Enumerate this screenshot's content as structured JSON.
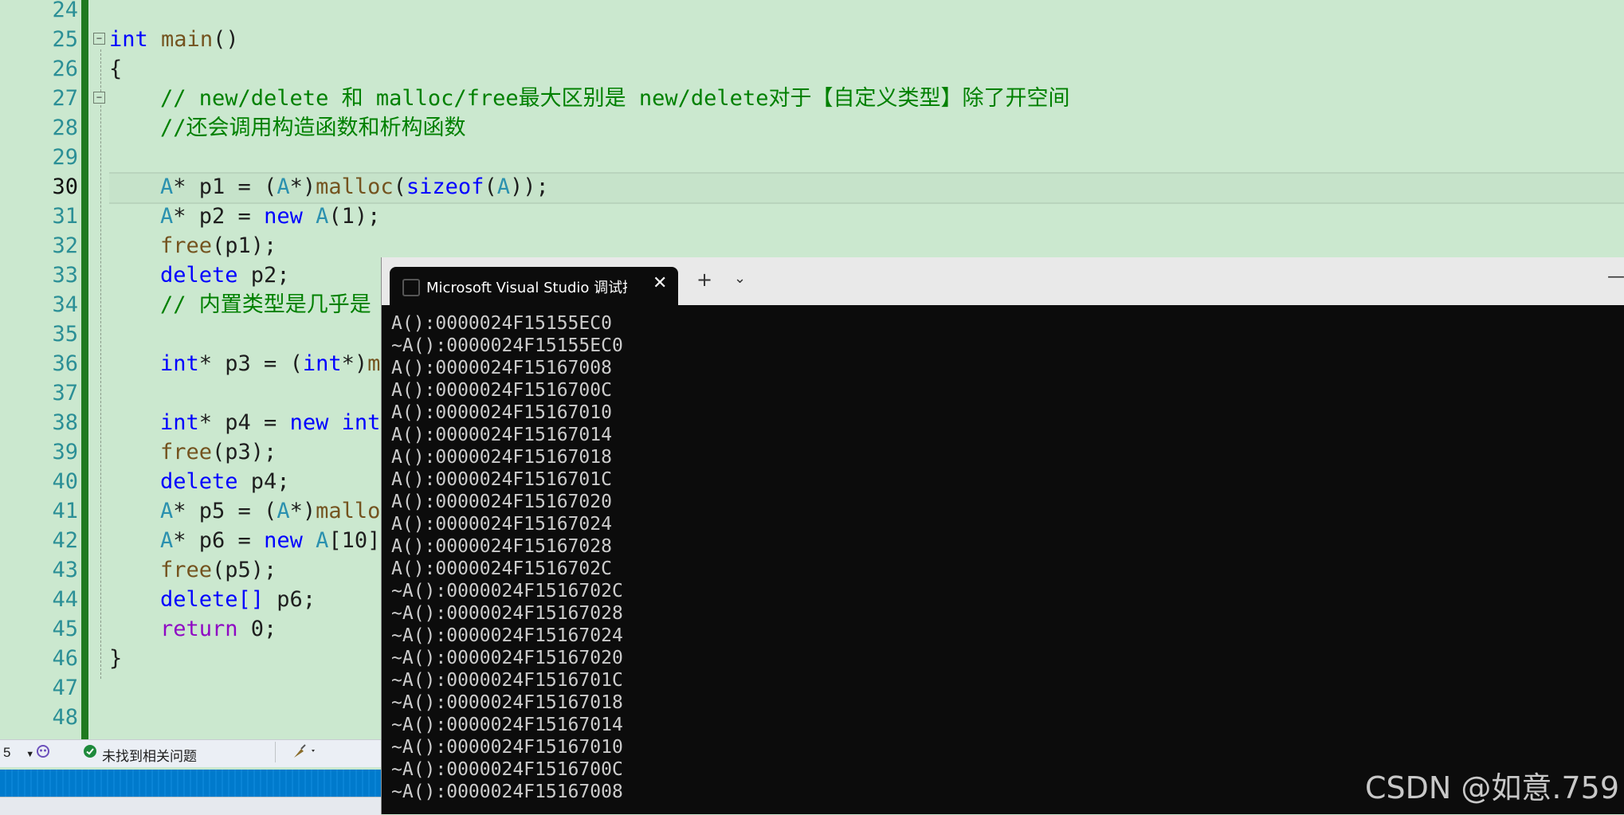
{
  "editor": {
    "line_numbers": [
      "24",
      "25",
      "26",
      "27",
      "28",
      "29",
      "30",
      "31",
      "32",
      "33",
      "34",
      "35",
      "36",
      "37",
      "38",
      "39",
      "40",
      "41",
      "42",
      "43",
      "44",
      "45",
      "46",
      "47",
      "48"
    ],
    "current_line": "30",
    "lines": {
      "l25": {
        "kw": "int",
        "fn": "main",
        "rest": "()"
      },
      "l26": "{",
      "l27": "// new/delete 和 malloc/free最大区别是 new/delete对于【自定义类型】除了开空间",
      "l28": "//还会调用构造函数和析构函数",
      "l30": {
        "t1": "A",
        "p1": "* p1 = (",
        "t2": "A",
        "p2": "*)",
        "fn": "malloc",
        "p3": "(",
        "kw": "sizeof",
        "p4": "(",
        "t3": "A",
        "p5": "));"
      },
      "l31": {
        "t1": "A",
        "p1": "* p2 = ",
        "kw": "new",
        "sp": " ",
        "t2": "A",
        "p2": "(1);"
      },
      "l32": {
        "fn": "free",
        "p1": "(p1);"
      },
      "l33": {
        "kw": "delete",
        "p1": " p2;"
      },
      "l34": "// 内置类型是几乎是",
      "l36": {
        "kw1": "int",
        "p1": "* p3 = (",
        "kw2": "int",
        "p2": "*)",
        "fn": "m"
      },
      "l38": {
        "kw1": "int",
        "p1": "* p4 = ",
        "kw2": "new",
        "sp": " ",
        "kw3": "int"
      },
      "l39": {
        "fn": "free",
        "p1": "(p3);"
      },
      "l40": {
        "kw": "delete",
        "p1": " p4;"
      },
      "l41": {
        "t1": "A",
        "p1": "* p5 = (",
        "t2": "A",
        "p2": "*)",
        "fn": "mallo"
      },
      "l42": {
        "t1": "A",
        "p1": "* p6 = ",
        "kw": "new",
        "sp": " ",
        "t2": "A",
        "p2": "[10]"
      },
      "l43": {
        "fn": "free",
        "p1": "(p5);"
      },
      "l44": {
        "kw": "delete[]",
        "p1": " p6;"
      },
      "l45": {
        "kw": "return",
        "p1": " 0;"
      },
      "l46": "}"
    }
  },
  "status_bar": {
    "issues_text": "未找到相关问题",
    "left_fragment": "5"
  },
  "console": {
    "tab_title": "Microsoft Visual Studio 调试控制台",
    "close_glyph": "✕",
    "new_tab_glyph": "+",
    "dropdown_glyph": "⌄",
    "minimize_glyph": "—",
    "output_lines": [
      "A():0000024F15155EC0",
      "~A():0000024F15155EC0",
      "A():0000024F15167008",
      "A():0000024F1516700C",
      "A():0000024F15167010",
      "A():0000024F15167014",
      "A():0000024F15167018",
      "A():0000024F1516701C",
      "A():0000024F15167020",
      "A():0000024F15167024",
      "A():0000024F15167028",
      "A():0000024F1516702C",
      "~A():0000024F1516702C",
      "~A():0000024F15167028",
      "~A():0000024F15167024",
      "~A():0000024F15167020",
      "~A():0000024F1516701C",
      "~A():0000024F15167018",
      "~A():0000024F15167014",
      "~A():0000024F15167010",
      "~A():0000024F1516700C",
      "~A():0000024F15167008"
    ]
  },
  "watermark": "CSDN @如意.759",
  "colors": {
    "editor_bg": "#cbe8cf",
    "keyword": "#0000ff",
    "type": "#2b91af",
    "function": "#74531f",
    "comment": "#008000",
    "control": "#8f08c4",
    "console_bg": "#0c0c0c",
    "console_text": "#cccccc"
  }
}
